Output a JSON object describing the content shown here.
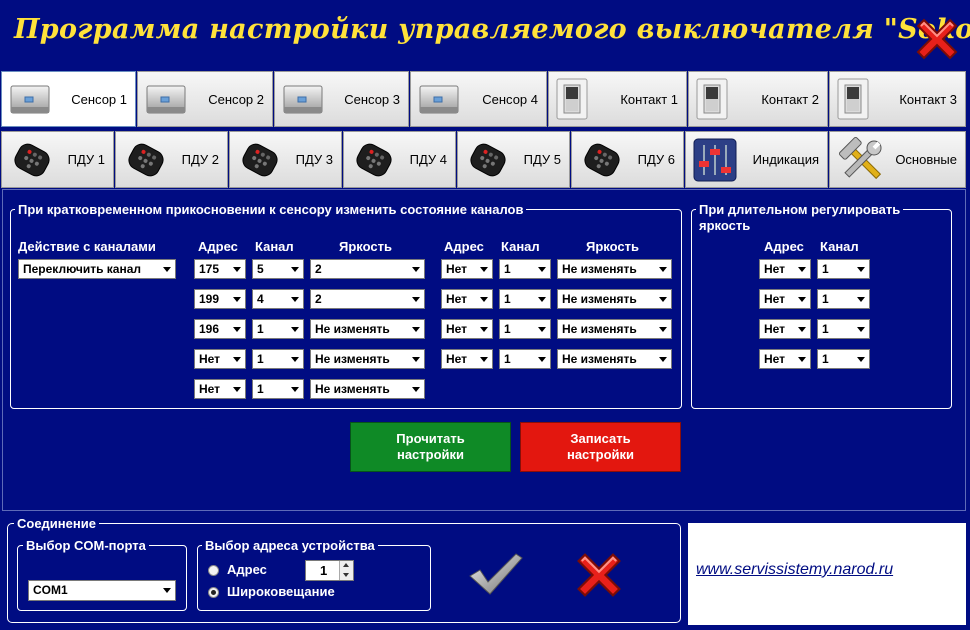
{
  "title": "Программа настройки управляемого выключателя \"Sokol\"",
  "tabs_row1": [
    {
      "label": "Сенсор 1",
      "icon": "sensor-icon",
      "active": true
    },
    {
      "label": "Сенсор 2",
      "icon": "sensor-icon"
    },
    {
      "label": "Сенсор 3",
      "icon": "sensor-icon"
    },
    {
      "label": "Сенсор 4",
      "icon": "sensor-icon"
    },
    {
      "label": "Контакт 1",
      "icon": "switch-icon"
    },
    {
      "label": "Контакт 2",
      "icon": "switch-icon"
    },
    {
      "label": "Контакт 3",
      "icon": "switch-icon"
    }
  ],
  "tabs_row2": [
    {
      "label": "ПДУ 1",
      "icon": "remote-icon"
    },
    {
      "label": "ПДУ 2",
      "icon": "remote-icon"
    },
    {
      "label": "ПДУ 3",
      "icon": "remote-icon"
    },
    {
      "label": "ПДУ 4",
      "icon": "remote-icon"
    },
    {
      "label": "ПДУ 5",
      "icon": "remote-icon"
    },
    {
      "label": "ПДУ 6",
      "icon": "remote-icon"
    },
    {
      "label": "Индикация",
      "icon": "equalizer-icon"
    },
    {
      "label": "Основные",
      "icon": "tools-icon"
    }
  ],
  "short_touch": {
    "title": "При кратковременном прикосновении к сенсору изменить состояние каналов",
    "action_header": "Действие с каналами",
    "action_value": "Переключить канал",
    "h_addr": "Адрес",
    "h_chan": "Канал",
    "h_bright": "Яркость",
    "left_rows": [
      {
        "addr": "175",
        "chan": "5",
        "bright": "2"
      },
      {
        "addr": "199",
        "chan": "4",
        "bright": "2"
      },
      {
        "addr": "196",
        "chan": "1",
        "bright": "Не изменять"
      },
      {
        "addr": "Нет",
        "chan": "1",
        "bright": "Не изменять"
      },
      {
        "addr": "Нет",
        "chan": "1",
        "bright": "Не изменять"
      }
    ],
    "right_rows": [
      {
        "addr": "Нет",
        "chan": "1",
        "bright": "Не изменять"
      },
      {
        "addr": "Нет",
        "chan": "1",
        "bright": "Не изменять"
      },
      {
        "addr": "Нет",
        "chan": "1",
        "bright": "Не изменять"
      },
      {
        "addr": "Нет",
        "chan": "1",
        "bright": "Не изменять"
      }
    ]
  },
  "long_touch": {
    "title_line1": "При длительном регулировать",
    "title_line2": "яркость",
    "h_addr": "Адрес",
    "h_chan": "Канал",
    "rows": [
      {
        "addr": "Нет",
        "chan": "1"
      },
      {
        "addr": "Нет",
        "chan": "1"
      },
      {
        "addr": "Нет",
        "chan": "1"
      },
      {
        "addr": "Нет",
        "chan": "1"
      }
    ]
  },
  "buttons": {
    "read_line1": "Прочитать",
    "read_line2": "настройки",
    "write_line1": "Записать",
    "write_line2": "настройки",
    "read_color": "#0f8a26",
    "write_color": "#e3170f"
  },
  "connection": {
    "title": "Соединение",
    "com_title": "Выбор COM-порта",
    "com_value": "COM1",
    "addr_title": "Выбор адреса устройства",
    "radio_addr_label": "Адрес",
    "radio_broadcast_label": "Широковещание",
    "selected": "broadcast",
    "addr_value": "1"
  },
  "website": "www.servissistemy.narod.ru",
  "colors": {
    "background": "#000c82",
    "title": "#ffe23a",
    "accent_red": "#e3170f",
    "accent_green": "#0f8a26"
  }
}
